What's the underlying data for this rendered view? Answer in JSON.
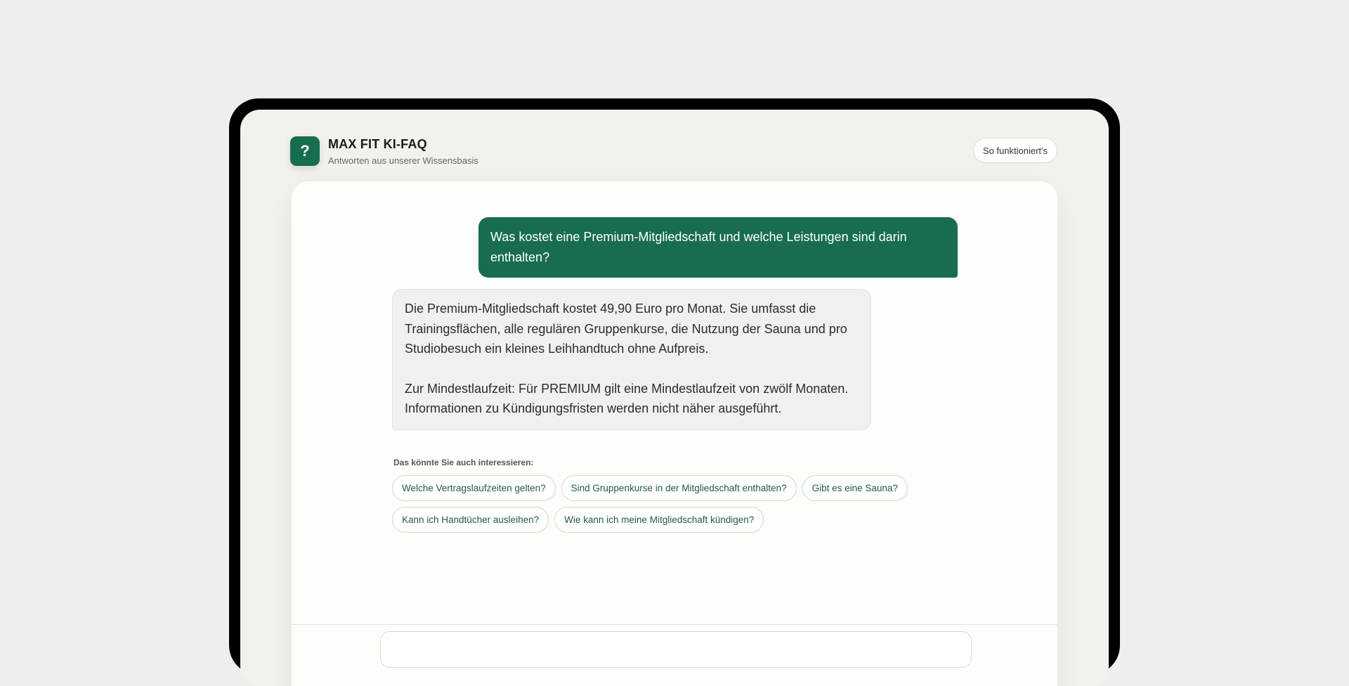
{
  "header": {
    "logo_glyph": "?",
    "title": "MAX FIT KI-FAQ",
    "subtitle": "Antworten aus unserer Wissensbasis",
    "how_it_works_label": "So funktioniert's"
  },
  "chat": {
    "user_message": "Was kostet eine Premium-Mitgliedschaft und welche Leistungen sind darin enthalten?",
    "bot_message": {
      "paragraph_1": "Die Premium-Mitgliedschaft kostet 49,90 Euro pro Monat. Sie umfasst die Trainingsflächen, alle regulären Gruppenkurse, die Nutzung der Sauna und pro Studiobesuch ein kleines Leihhandtuch ohne Aufpreis.",
      "paragraph_2": "Zur Mindestlaufzeit: Für PREMIUM gilt eine Mindestlaufzeit von zwölf Monaten. Informationen zu Kündigungsfristen werden nicht näher ausgeführt."
    }
  },
  "suggestions": {
    "label": "Das könnte Sie auch interessieren:",
    "items": [
      "Welche Vertragslaufzeiten gelten?",
      "Sind Gruppenkurse in der Mitgliedschaft enthalten?",
      "Gibt es eine Sauna?",
      "Kann ich Handtücher ausleihen?",
      "Wie kann ich meine Mitgliedschaft kündigen?"
    ]
  },
  "colors": {
    "brand": "#186d4f",
    "page_background": "#eeeeee",
    "device_frame": "#000000"
  }
}
